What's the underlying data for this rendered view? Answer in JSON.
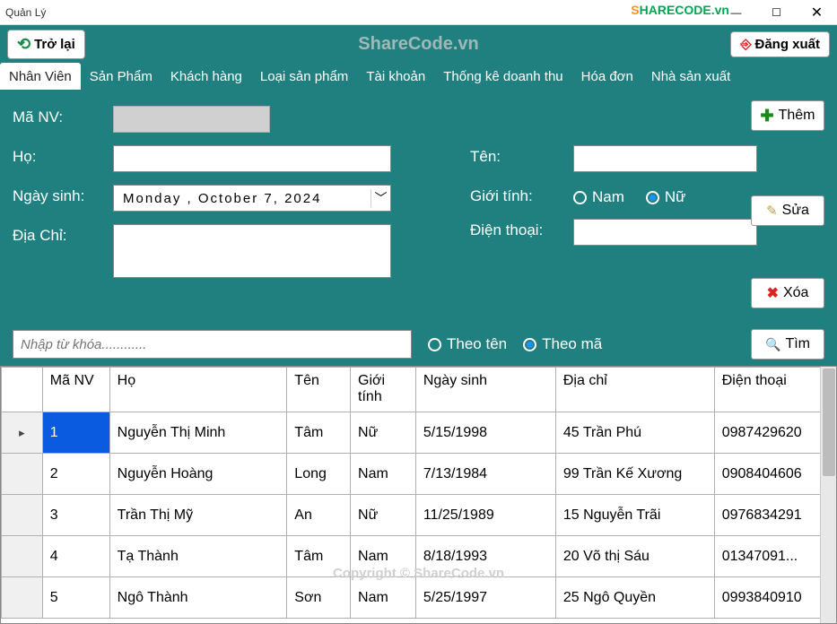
{
  "window": {
    "title": "Quản Lý"
  },
  "watermark": {
    "logo_s": "S",
    "logo_rest": "HARECODE.vn",
    "copyright": "Copyright © ShareCode.vn"
  },
  "toolbar": {
    "back_label": "Trở lại",
    "center_title": "ShareCode.vn",
    "logout_label": "Đăng xuất"
  },
  "tabs": [
    {
      "label": "Nhân Viên",
      "active": true
    },
    {
      "label": "Sản Phẩm",
      "active": false
    },
    {
      "label": "Khách hàng",
      "active": false
    },
    {
      "label": "Loại sản phẩm",
      "active": false
    },
    {
      "label": "Tài khoản",
      "active": false
    },
    {
      "label": "Thống kê doanh thu",
      "active": false
    },
    {
      "label": "Hóa đơn",
      "active": false
    },
    {
      "label": "Nhà sản xuất",
      "active": false
    }
  ],
  "form": {
    "labels": {
      "manv": "Mã NV:",
      "ho": "Họ:",
      "ten": "Tên:",
      "ngaysinh": "Ngày sinh:",
      "gioitinh": "Giới tính:",
      "diachi": "Địa Chỉ:",
      "dienthoai": "Điện thoại:"
    },
    "date_value": "Monday  ,  October   7, 2024",
    "gender": {
      "opt1": "Nam",
      "opt2": "Nữ",
      "selected": "Nữ"
    }
  },
  "actions": {
    "them": "Thêm",
    "sua": "Sửa",
    "xoa": "Xóa",
    "tim": "Tìm"
  },
  "search": {
    "placeholder": "Nhập từ khóa............",
    "opt1": "Theo tên",
    "opt2": "Theo mã",
    "selected": "Theo mã"
  },
  "table": {
    "headers": {
      "manv": "Mã NV",
      "ho": "Họ",
      "ten": "Tên",
      "gt": "Giới tính",
      "ns": "Ngày sinh",
      "dc": "Địa chỉ",
      "dt": "Điện thoại"
    },
    "rows": [
      {
        "ma": "1",
        "ho": "Nguyễn Thị Minh",
        "ten": "Tâm",
        "gt": "Nữ",
        "ns": "5/15/1998",
        "dc": "45 Trần Phú",
        "dt": "0987429620",
        "selected": true
      },
      {
        "ma": "2",
        "ho": "Nguyễn Hoàng",
        "ten": "Long",
        "gt": "Nam",
        "ns": "7/13/1984",
        "dc": "99 Trần Kế Xương",
        "dt": "0908404606"
      },
      {
        "ma": "3",
        "ho": "Trần Thị Mỹ",
        "ten": "An",
        "gt": "Nữ",
        "ns": "11/25/1989",
        "dc": "15 Nguyễn Trãi",
        "dt": "0976834291"
      },
      {
        "ma": "4",
        "ho": "Tạ Thành",
        "ten": "Tâm",
        "gt": "Nam",
        "ns": "8/18/1993",
        "dc": "20 Võ thị Sáu",
        "dt": "01347091..."
      },
      {
        "ma": "5",
        "ho": "Ngô Thành",
        "ten": "Sơn",
        "gt": "Nam",
        "ns": "5/25/1997",
        "dc": "25 Ngô Quyền",
        "dt": "0993840910"
      }
    ]
  }
}
